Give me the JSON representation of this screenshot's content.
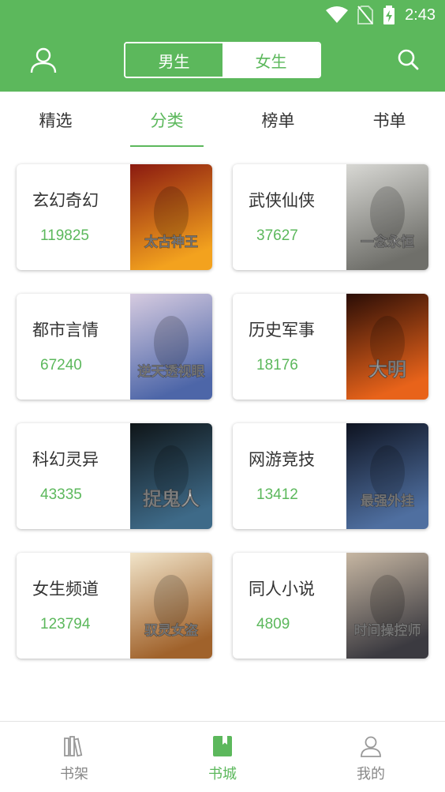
{
  "status_bar": {
    "time": "2:43"
  },
  "header": {
    "gender_options": [
      {
        "label": "男生",
        "selected": true
      },
      {
        "label": "女生",
        "selected": false
      }
    ]
  },
  "tabs": [
    {
      "label": "精选",
      "active": false
    },
    {
      "label": "分类",
      "active": true
    },
    {
      "label": "榜单",
      "active": false
    },
    {
      "label": "书单",
      "active": false
    }
  ],
  "categories": [
    {
      "name": "玄幻奇幻",
      "count": "119825",
      "cover_text": "太古神王",
      "cover_colors": [
        "#8b1a10",
        "#f3a21e"
      ]
    },
    {
      "name": "武侠仙侠",
      "count": "37627",
      "cover_text": "一念永恒",
      "cover_colors": [
        "#d8d8d4",
        "#6f6f6a"
      ]
    },
    {
      "name": "都市言情",
      "count": "67240",
      "cover_text": "逆天透视眼",
      "cover_colors": [
        "#d6cbe0",
        "#4d66a8"
      ]
    },
    {
      "name": "历史军事",
      "count": "18176",
      "cover_text": "大明",
      "cover_colors": [
        "#2a0d06",
        "#e8631a"
      ]
    },
    {
      "name": "科幻灵异",
      "count": "43335",
      "cover_text": "捉鬼人",
      "cover_colors": [
        "#0f1518",
        "#3e6a88"
      ]
    },
    {
      "name": "网游竞技",
      "count": "13412",
      "cover_text": "最强外挂",
      "cover_colors": [
        "#0e1320",
        "#4f6fa0"
      ]
    },
    {
      "name": "女生频道",
      "count": "123794",
      "cover_text": "驭灵女盗",
      "cover_colors": [
        "#f1e4c9",
        "#a0622b"
      ]
    },
    {
      "name": "同人小说",
      "count": "4809",
      "cover_text": "时间操控师",
      "cover_colors": [
        "#c6b6a2",
        "#3b3a40"
      ]
    }
  ],
  "bottom_nav": [
    {
      "label": "书架",
      "active": false
    },
    {
      "label": "书城",
      "active": true
    },
    {
      "label": "我的",
      "active": false
    }
  ],
  "colors": {
    "accent": "#5cb85c",
    "text": "#333333",
    "muted": "#888888"
  }
}
